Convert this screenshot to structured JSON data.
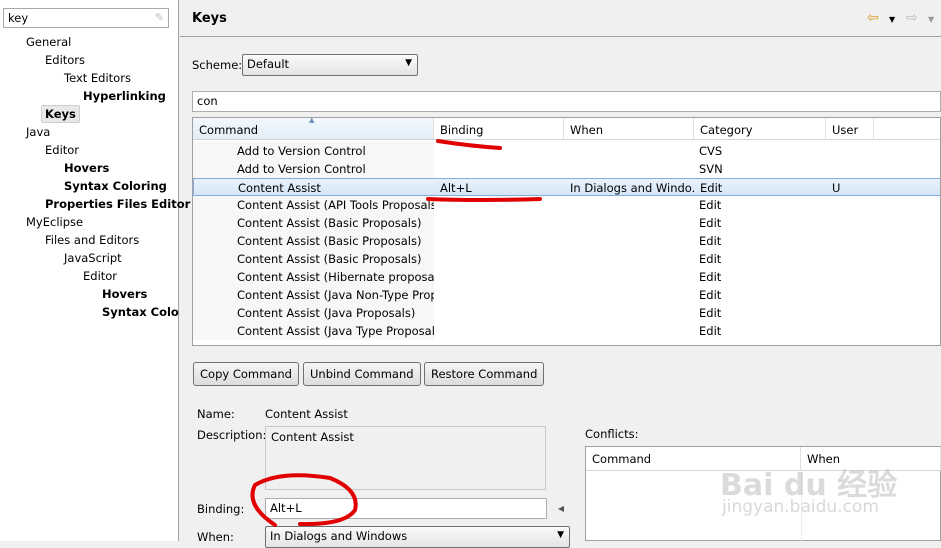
{
  "sidebar": {
    "filter_value": "key",
    "items": [
      {
        "label": "General",
        "level": 0,
        "bold": false
      },
      {
        "label": "Editors",
        "level": 1,
        "bold": false
      },
      {
        "label": "Text Editors",
        "level": 2,
        "bold": false
      },
      {
        "label": "Hyperlinking",
        "level": 3,
        "bold": true
      },
      {
        "label": "Keys",
        "level": 1,
        "bold": true,
        "selected": true
      },
      {
        "label": "Java",
        "level": 0,
        "bold": false
      },
      {
        "label": "Editor",
        "level": 1,
        "bold": false
      },
      {
        "label": "Hovers",
        "level": 2,
        "bold": true
      },
      {
        "label": "Syntax Coloring",
        "level": 2,
        "bold": true
      },
      {
        "label": "Properties Files Editor",
        "level": 1,
        "bold": true
      },
      {
        "label": "MyEclipse",
        "level": 0,
        "bold": false
      },
      {
        "label": "Files and Editors",
        "level": 1,
        "bold": false
      },
      {
        "label": "JavaScript",
        "level": 2,
        "bold": false
      },
      {
        "label": "Editor",
        "level": 3,
        "bold": false
      },
      {
        "label": "Hovers",
        "level": 4,
        "bold": true
      },
      {
        "label": "Syntax Colo",
        "level": 4,
        "bold": true
      }
    ]
  },
  "header": {
    "title": "Keys",
    "back_icon": "arrow-left-icon",
    "forward_icon": "arrow-right-icon"
  },
  "scheme": {
    "label": "Scheme:",
    "value": "Default"
  },
  "filter": {
    "value": "con"
  },
  "table": {
    "columns": [
      "Command",
      "Binding",
      "When",
      "Category",
      "User"
    ],
    "rows": [
      [
        "Add to Version Control",
        "",
        "",
        "CVS",
        ""
      ],
      [
        "Add to Version Control",
        "",
        "",
        "SVN",
        ""
      ],
      [
        "Content Assist",
        "Alt+L",
        "In Dialogs and Windo...",
        "Edit",
        "U"
      ],
      [
        "Content Assist (API Tools Proposals)",
        "",
        "",
        "Edit",
        ""
      ],
      [
        "Content Assist (Basic Proposals)",
        "",
        "",
        "Edit",
        ""
      ],
      [
        "Content Assist (Basic Proposals)",
        "",
        "",
        "Edit",
        ""
      ],
      [
        "Content Assist (Basic Proposals)",
        "",
        "",
        "Edit",
        ""
      ],
      [
        "Content Assist (Hibernate proposals)",
        "",
        "",
        "Edit",
        ""
      ],
      [
        "Content Assist (Java Non-Type Propo",
        "",
        "",
        "Edit",
        ""
      ],
      [
        "Content Assist (Java Proposals)",
        "",
        "",
        "Edit",
        ""
      ],
      [
        "Content Assist (Java Type Proposals)",
        "",
        "",
        "Edit",
        ""
      ]
    ],
    "selected_row": 2
  },
  "buttons": {
    "copy": "Copy Command",
    "unbind": "Unbind Command",
    "restore": "Restore Command"
  },
  "details": {
    "name_label": "Name:",
    "name_value": "Content Assist",
    "description_label": "Description:",
    "description_value": "Content Assist",
    "binding_label": "Binding:",
    "binding_value": "Alt+L",
    "when_label": "When:",
    "when_value": "In Dialogs and Windows"
  },
  "conflicts": {
    "label": "Conflicts:",
    "columns": [
      "Command",
      "When"
    ]
  },
  "watermark": {
    "text": "Bai du 经验",
    "url_text": "jingyan.baidu.com"
  },
  "annotation_color": "#e00000"
}
